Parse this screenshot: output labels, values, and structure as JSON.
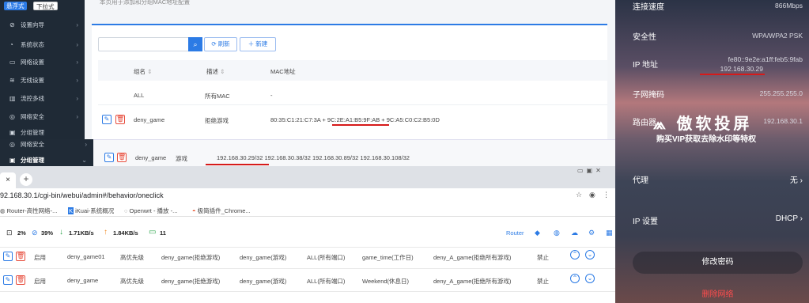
{
  "sidebar_top": {
    "tag_active": "悬浮式",
    "tag_inactive": "下拉式",
    "items": [
      {
        "icon": "⊘",
        "label": "设置向导"
      },
      {
        "icon": "◔",
        "label": "系统状态"
      },
      {
        "icon": "▭",
        "label": "网络设置"
      },
      {
        "icon": "≋",
        "label": "无线设置"
      },
      {
        "icon": "▥",
        "label": "流控多线"
      },
      {
        "icon": "◎",
        "label": "网络安全"
      },
      {
        "icon": "▣",
        "label": "分组管理"
      }
    ]
  },
  "sidebar_bottom": {
    "items": [
      {
        "icon": "◎",
        "label": "网络安全"
      },
      {
        "icon": "▣",
        "label": "分组管理"
      }
    ]
  },
  "top_panel": {
    "note": "本页用于添加和分组MAC地址配置",
    "refresh_label": "刷新",
    "new_label": "新建",
    "headers": [
      "组名",
      "描述",
      "MAC地址"
    ],
    "rows": [
      {
        "name": "ALL",
        "desc": "所有MAC",
        "mac": "-"
      },
      {
        "name": "deny_game",
        "desc": "拒绝游戏",
        "mac": "80:35:C1:21:C7:3A + 9C:2E:A1:B5:9F:AB + 9C:A5:C0:C2:B5:0D"
      }
    ]
  },
  "ip_group_row": {
    "name": "deny_game",
    "desc": "游戏",
    "ips": "192.168.30.29/32  192.168.30.38/32  192.168.30.89/32  192.168.30.108/32"
  },
  "browser": {
    "url": "92.168.30.1/cgi-bin/webui/admin#/behavior/oneclick",
    "bookmarks": [
      "Router-高性网络-...",
      "iKuai-系统概况",
      "Openwrt - 播放 -...",
      "极简插件_Chrome..."
    ],
    "status": {
      "cpu": "2%",
      "mem": "39%",
      "down": "1.71KB/s",
      "up": "1.84KB/s",
      "devices": "11"
    },
    "router_label": "Router",
    "rules": [
      {
        "state": "启用",
        "name": "deny_game01",
        "priority": "高优先级",
        "src": "deny_game(拒绝游戏)",
        "app": "deny_game(游戏)",
        "port": "ALL(所有端口)",
        "time": "game_time(工作日)",
        "dst": "deny_A_game(拒绝所有游戏)",
        "action": "禁止"
      },
      {
        "state": "启用",
        "name": "deny_game",
        "priority": "高优先级",
        "src": "deny_game(拒绝游戏)",
        "app": "deny_game(游戏)",
        "port": "ALL(所有端口)",
        "time": "Weekend(休息日)",
        "dst": "deny_A_game(拒绝所有游戏)",
        "action": "禁止"
      }
    ]
  },
  "phone": {
    "speed_label": "连接速度",
    "speed_value": "866Mbps",
    "security_label": "安全性",
    "security_value": "WPA/WPA2 PSK",
    "ip_label": "IP 地址",
    "ip_v6": "fe80::9e2e:a1ff:feb5:9fab",
    "ip_v4": "192.168.30.29",
    "mask_label": "子网掩码",
    "mask_value": "255.255.255.0",
    "router_label": "路由器",
    "router_value": "192.168.30.1",
    "watermark_title": "傲软投屏",
    "watermark_sub": "购买VIP获取去除水印等特权",
    "proxy_label": "代理",
    "proxy_value": "无",
    "ipset_label": "IP 设置",
    "ipset_value": "DHCP",
    "change_pw": "修改密码",
    "delete_net": "删除网络"
  }
}
